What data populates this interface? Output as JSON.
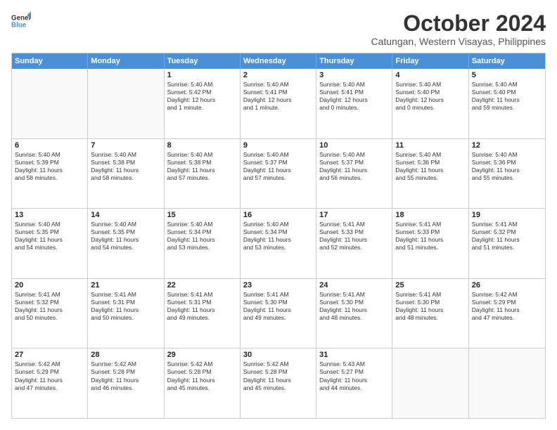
{
  "logo": {
    "line1": "General",
    "line2": "Blue"
  },
  "title": "October 2024",
  "subtitle": "Catungan, Western Visayas, Philippines",
  "headers": [
    "Sunday",
    "Monday",
    "Tuesday",
    "Wednesday",
    "Thursday",
    "Friday",
    "Saturday"
  ],
  "rows": [
    [
      {
        "day": "",
        "text": ""
      },
      {
        "day": "",
        "text": ""
      },
      {
        "day": "1",
        "text": "Sunrise: 5:40 AM\nSunset: 5:42 PM\nDaylight: 12 hours\nand 1 minute."
      },
      {
        "day": "2",
        "text": "Sunrise: 5:40 AM\nSunset: 5:41 PM\nDaylight: 12 hours\nand 1 minute."
      },
      {
        "day": "3",
        "text": "Sunrise: 5:40 AM\nSunset: 5:41 PM\nDaylight: 12 hours\nand 0 minutes."
      },
      {
        "day": "4",
        "text": "Sunrise: 5:40 AM\nSunset: 5:40 PM\nDaylight: 12 hours\nand 0 minutes."
      },
      {
        "day": "5",
        "text": "Sunrise: 5:40 AM\nSunset: 5:40 PM\nDaylight: 11 hours\nand 59 minutes."
      }
    ],
    [
      {
        "day": "6",
        "text": "Sunrise: 5:40 AM\nSunset: 5:39 PM\nDaylight: 11 hours\nand 58 minutes."
      },
      {
        "day": "7",
        "text": "Sunrise: 5:40 AM\nSunset: 5:38 PM\nDaylight: 11 hours\nand 58 minutes."
      },
      {
        "day": "8",
        "text": "Sunrise: 5:40 AM\nSunset: 5:38 PM\nDaylight: 11 hours\nand 57 minutes."
      },
      {
        "day": "9",
        "text": "Sunrise: 5:40 AM\nSunset: 5:37 PM\nDaylight: 11 hours\nand 57 minutes."
      },
      {
        "day": "10",
        "text": "Sunrise: 5:40 AM\nSunset: 5:37 PM\nDaylight: 11 hours\nand 56 minutes."
      },
      {
        "day": "11",
        "text": "Sunrise: 5:40 AM\nSunset: 5:36 PM\nDaylight: 11 hours\nand 55 minutes."
      },
      {
        "day": "12",
        "text": "Sunrise: 5:40 AM\nSunset: 5:36 PM\nDaylight: 11 hours\nand 55 minutes."
      }
    ],
    [
      {
        "day": "13",
        "text": "Sunrise: 5:40 AM\nSunset: 5:35 PM\nDaylight: 11 hours\nand 54 minutes."
      },
      {
        "day": "14",
        "text": "Sunrise: 5:40 AM\nSunset: 5:35 PM\nDaylight: 11 hours\nand 54 minutes."
      },
      {
        "day": "15",
        "text": "Sunrise: 5:40 AM\nSunset: 5:34 PM\nDaylight: 11 hours\nand 53 minutes."
      },
      {
        "day": "16",
        "text": "Sunrise: 5:40 AM\nSunset: 5:34 PM\nDaylight: 11 hours\nand 53 minutes."
      },
      {
        "day": "17",
        "text": "Sunrise: 5:41 AM\nSunset: 5:33 PM\nDaylight: 11 hours\nand 52 minutes."
      },
      {
        "day": "18",
        "text": "Sunrise: 5:41 AM\nSunset: 5:33 PM\nDaylight: 11 hours\nand 51 minutes."
      },
      {
        "day": "19",
        "text": "Sunrise: 5:41 AM\nSunset: 5:32 PM\nDaylight: 11 hours\nand 51 minutes."
      }
    ],
    [
      {
        "day": "20",
        "text": "Sunrise: 5:41 AM\nSunset: 5:32 PM\nDaylight: 11 hours\nand 50 minutes."
      },
      {
        "day": "21",
        "text": "Sunrise: 5:41 AM\nSunset: 5:31 PM\nDaylight: 11 hours\nand 50 minutes."
      },
      {
        "day": "22",
        "text": "Sunrise: 5:41 AM\nSunset: 5:31 PM\nDaylight: 11 hours\nand 49 minutes."
      },
      {
        "day": "23",
        "text": "Sunrise: 5:41 AM\nSunset: 5:30 PM\nDaylight: 11 hours\nand 49 minutes."
      },
      {
        "day": "24",
        "text": "Sunrise: 5:41 AM\nSunset: 5:30 PM\nDaylight: 11 hours\nand 48 minutes."
      },
      {
        "day": "25",
        "text": "Sunrise: 5:41 AM\nSunset: 5:30 PM\nDaylight: 11 hours\nand 48 minutes."
      },
      {
        "day": "26",
        "text": "Sunrise: 5:42 AM\nSunset: 5:29 PM\nDaylight: 11 hours\nand 47 minutes."
      }
    ],
    [
      {
        "day": "27",
        "text": "Sunrise: 5:42 AM\nSunset: 5:29 PM\nDaylight: 11 hours\nand 47 minutes."
      },
      {
        "day": "28",
        "text": "Sunrise: 5:42 AM\nSunset: 5:28 PM\nDaylight: 11 hours\nand 46 minutes."
      },
      {
        "day": "29",
        "text": "Sunrise: 5:42 AM\nSunset: 5:28 PM\nDaylight: 11 hours\nand 45 minutes."
      },
      {
        "day": "30",
        "text": "Sunrise: 5:42 AM\nSunset: 5:28 PM\nDaylight: 11 hours\nand 45 minutes."
      },
      {
        "day": "31",
        "text": "Sunrise: 5:43 AM\nSunset: 5:27 PM\nDaylight: 11 hours\nand 44 minutes."
      },
      {
        "day": "",
        "text": ""
      },
      {
        "day": "",
        "text": ""
      }
    ]
  ]
}
